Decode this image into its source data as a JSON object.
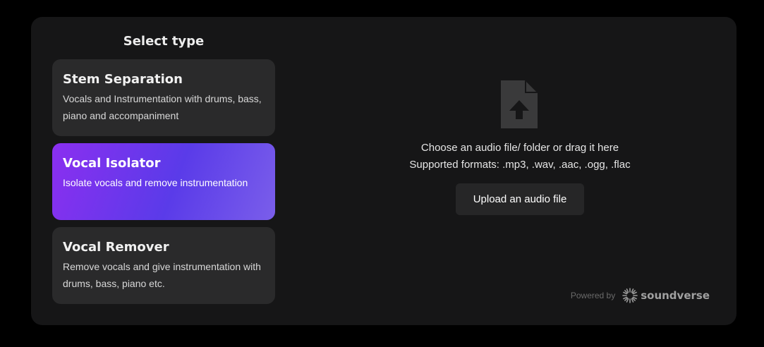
{
  "section_title": "Select type",
  "cards": [
    {
      "title": "Stem Separation",
      "description": "Vocals and Instrumentation with drums, bass, piano and accompaniment",
      "selected": false
    },
    {
      "title": "Vocal Isolator",
      "description": "Isolate vocals and remove instrumentation",
      "selected": true
    },
    {
      "title": "Vocal Remover",
      "description": "Remove vocals and give instrumentation with drums, bass, piano etc.",
      "selected": false
    }
  ],
  "dropzone": {
    "icon": "file-upload-icon",
    "instruction": "Choose an audio file/ folder or drag it here",
    "formats": "Supported formats: .mp3, .wav, .aac, .ogg, .flac",
    "upload_label": "Upload an audio file"
  },
  "footer": {
    "powered_by": "Powered by",
    "brand_name": "soundverse",
    "brand_icon": "soundverse-logo-icon"
  },
  "colors": {
    "panel_bg": "#161617",
    "card_bg": "#2a2a2b",
    "selected_gradient_start": "#8b2ff0",
    "selected_gradient_end": "#5a3be9"
  }
}
